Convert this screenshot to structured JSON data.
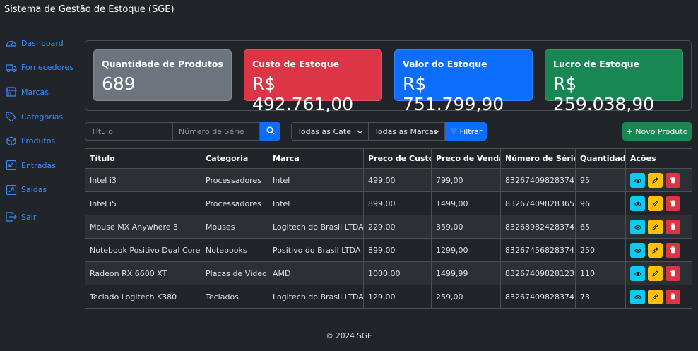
{
  "app": {
    "title": "Sistema de Gestão de Estoque (SGE)"
  },
  "sidebar": {
    "items": [
      {
        "label": "Dashboard",
        "icon": "speedometer-icon"
      },
      {
        "label": "Fornecedores",
        "icon": "truck-icon"
      },
      {
        "label": "Marcas",
        "icon": "shop-icon"
      },
      {
        "label": "Categorias",
        "icon": "tags-icon"
      },
      {
        "label": "Produtos",
        "icon": "box-icon"
      },
      {
        "label": "Entradas",
        "icon": "arrow-down-left-square-icon"
      },
      {
        "label": "Saídas",
        "icon": "arrow-up-right-square-icon"
      },
      {
        "label": "Sair",
        "icon": "box-arrow-right-icon"
      }
    ]
  },
  "metrics": [
    {
      "title": "Quantidade de Produtos",
      "value": "689",
      "color": "#6c757d"
    },
    {
      "title": "Custo de Estoque",
      "value": "R$ 492.761,00",
      "color": "#dc3545"
    },
    {
      "title": "Valor do Estoque",
      "value": "R$ 751.799,90",
      "color": "#0d6efd"
    },
    {
      "title": "Lucro de Estoque",
      "value": "R$ 259.038,90",
      "color": "#198754"
    }
  ],
  "filters": {
    "title_placeholder": "Título",
    "serial_placeholder": "Número de Série",
    "category_selected": "Todas as Categorias",
    "brand_selected": "Todas as Marcas",
    "filter_label": "Filtrar",
    "new_product_label": "+ Novo Produto"
  },
  "table": {
    "headers": [
      "Título",
      "Categoria",
      "Marca",
      "Preço de Custo",
      "Preço de Venda",
      "Número de Série",
      "Quantidade",
      "Ações"
    ],
    "rows": [
      [
        "Intel i3",
        "Processadores",
        "Intel",
        "499,00",
        "799,00",
        "83267409828374",
        "95"
      ],
      [
        "Intel i5",
        "Processadores",
        "Intel",
        "899,00",
        "1499,00",
        "83267409828365",
        "96"
      ],
      [
        "Mouse MX Anywhere 3",
        "Mouses",
        "Logitech do Brasil LTDA",
        "229,00",
        "359,00",
        "83268982428374",
        "65"
      ],
      [
        "Notebook Positivo Dual Core",
        "Notebooks",
        "Positivo do Brasil LTDA",
        "899,00",
        "1299,00",
        "83267456828374",
        "250"
      ],
      [
        "Radeon RX 6600 XT",
        "Placas de Vídeo",
        "AMD",
        "1000,00",
        "1499,99",
        "83267409828123",
        "110"
      ],
      [
        "Teclado Logitech K380",
        "Teclados",
        "Logitech do Brasil LTDA",
        "129,00",
        "259,00",
        "83267409828374",
        "73"
      ]
    ]
  },
  "footer": {
    "text": "© 2024 SGE"
  }
}
